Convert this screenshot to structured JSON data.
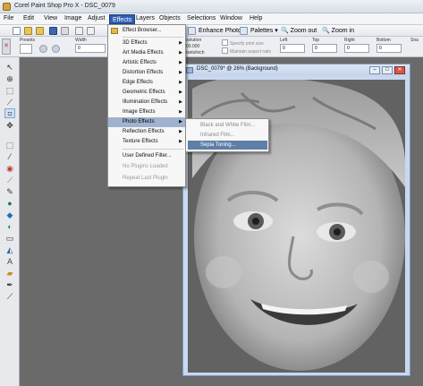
{
  "app": {
    "title": "Corel Paint Shop Pro X - DSC_0079"
  },
  "menubar": {
    "items": [
      "File",
      "Edit",
      "View",
      "Image",
      "Adjust",
      "Effects",
      "Layers",
      "Objects",
      "Selections",
      "Window",
      "Help"
    ]
  },
  "toolbar": {
    "enhance_photo": "Enhance Photo",
    "palettes": "Palettes",
    "zoom_out": "Zoom out",
    "zoom_in": "Zoom in"
  },
  "options": {
    "presets_label": "Presets",
    "width_label": "Width",
    "width_value": "0",
    "resolution_label": "solution",
    "resolution_value": "00.000",
    "resolution_unit": "ixels/inch",
    "specify_print_size": "Specify print size",
    "maintain_aspect": "Maintain aspect ratio",
    "left_label": "Left",
    "left_value": "0",
    "top_label": "Top",
    "top_value": "0",
    "right_label": "Right",
    "right_value": "0",
    "bottom_label": "Bottom",
    "bottom_value": "0",
    "cut_label": "Sna"
  },
  "document": {
    "title": "DSC_0079* @ 26% (Background)"
  },
  "effects_menu": {
    "items": [
      {
        "label": "Effect Browser...",
        "submenu": false
      },
      {
        "label": "3D Effects",
        "submenu": true
      },
      {
        "label": "Art Media Effects",
        "submenu": true
      },
      {
        "label": "Artistic Effects",
        "submenu": true
      },
      {
        "label": "Distortion Effects",
        "submenu": true
      },
      {
        "label": "Edge Effects",
        "submenu": true
      },
      {
        "label": "Geometric Effects",
        "submenu": true
      },
      {
        "label": "Illumination Effects",
        "submenu": true
      },
      {
        "label": "Image Effects",
        "submenu": true
      },
      {
        "label": "Photo Effects",
        "submenu": true
      },
      {
        "label": "Reflection Effects",
        "submenu": true
      },
      {
        "label": "Texture Effects",
        "submenu": true
      },
      {
        "label": "User Defined Filter...",
        "submenu": false
      },
      {
        "label": "No Plugins Loaded",
        "submenu": false
      },
      {
        "label": "Repeat Last Plugin",
        "submenu": false
      }
    ]
  },
  "photo_effects_submenu": {
    "items": [
      "Black and White Film...",
      "Infrared Film...",
      "Sepia Toning..."
    ]
  }
}
